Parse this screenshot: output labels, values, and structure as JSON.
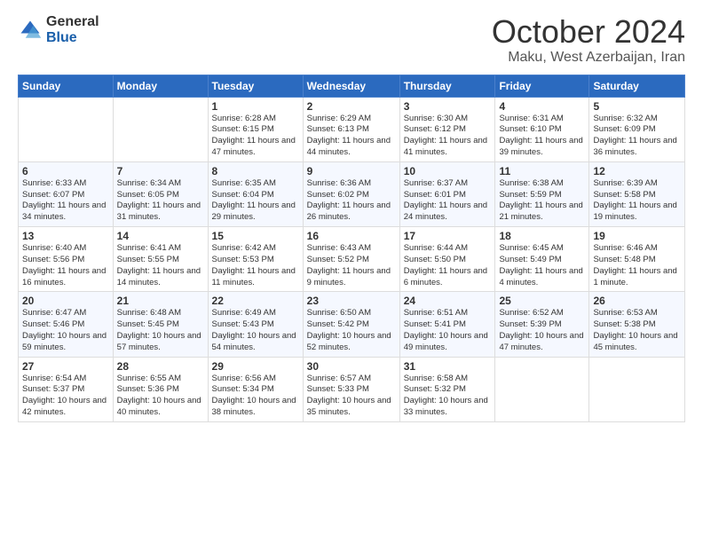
{
  "logo": {
    "general": "General",
    "blue": "Blue"
  },
  "title": {
    "month": "October 2024",
    "location": "Maku, West Azerbaijan, Iran"
  },
  "days_header": [
    "Sunday",
    "Monday",
    "Tuesday",
    "Wednesday",
    "Thursday",
    "Friday",
    "Saturday"
  ],
  "weeks": [
    [
      {
        "day": "",
        "detail": ""
      },
      {
        "day": "",
        "detail": ""
      },
      {
        "day": "1",
        "detail": "Sunrise: 6:28 AM\nSunset: 6:15 PM\nDaylight: 11 hours and 47 minutes."
      },
      {
        "day": "2",
        "detail": "Sunrise: 6:29 AM\nSunset: 6:13 PM\nDaylight: 11 hours and 44 minutes."
      },
      {
        "day": "3",
        "detail": "Sunrise: 6:30 AM\nSunset: 6:12 PM\nDaylight: 11 hours and 41 minutes."
      },
      {
        "day": "4",
        "detail": "Sunrise: 6:31 AM\nSunset: 6:10 PM\nDaylight: 11 hours and 39 minutes."
      },
      {
        "day": "5",
        "detail": "Sunrise: 6:32 AM\nSunset: 6:09 PM\nDaylight: 11 hours and 36 minutes."
      }
    ],
    [
      {
        "day": "6",
        "detail": "Sunrise: 6:33 AM\nSunset: 6:07 PM\nDaylight: 11 hours and 34 minutes."
      },
      {
        "day": "7",
        "detail": "Sunrise: 6:34 AM\nSunset: 6:05 PM\nDaylight: 11 hours and 31 minutes."
      },
      {
        "day": "8",
        "detail": "Sunrise: 6:35 AM\nSunset: 6:04 PM\nDaylight: 11 hours and 29 minutes."
      },
      {
        "day": "9",
        "detail": "Sunrise: 6:36 AM\nSunset: 6:02 PM\nDaylight: 11 hours and 26 minutes."
      },
      {
        "day": "10",
        "detail": "Sunrise: 6:37 AM\nSunset: 6:01 PM\nDaylight: 11 hours and 24 minutes."
      },
      {
        "day": "11",
        "detail": "Sunrise: 6:38 AM\nSunset: 5:59 PM\nDaylight: 11 hours and 21 minutes."
      },
      {
        "day": "12",
        "detail": "Sunrise: 6:39 AM\nSunset: 5:58 PM\nDaylight: 11 hours and 19 minutes."
      }
    ],
    [
      {
        "day": "13",
        "detail": "Sunrise: 6:40 AM\nSunset: 5:56 PM\nDaylight: 11 hours and 16 minutes."
      },
      {
        "day": "14",
        "detail": "Sunrise: 6:41 AM\nSunset: 5:55 PM\nDaylight: 11 hours and 14 minutes."
      },
      {
        "day": "15",
        "detail": "Sunrise: 6:42 AM\nSunset: 5:53 PM\nDaylight: 11 hours and 11 minutes."
      },
      {
        "day": "16",
        "detail": "Sunrise: 6:43 AM\nSunset: 5:52 PM\nDaylight: 11 hours and 9 minutes."
      },
      {
        "day": "17",
        "detail": "Sunrise: 6:44 AM\nSunset: 5:50 PM\nDaylight: 11 hours and 6 minutes."
      },
      {
        "day": "18",
        "detail": "Sunrise: 6:45 AM\nSunset: 5:49 PM\nDaylight: 11 hours and 4 minutes."
      },
      {
        "day": "19",
        "detail": "Sunrise: 6:46 AM\nSunset: 5:48 PM\nDaylight: 11 hours and 1 minute."
      }
    ],
    [
      {
        "day": "20",
        "detail": "Sunrise: 6:47 AM\nSunset: 5:46 PM\nDaylight: 10 hours and 59 minutes."
      },
      {
        "day": "21",
        "detail": "Sunrise: 6:48 AM\nSunset: 5:45 PM\nDaylight: 10 hours and 57 minutes."
      },
      {
        "day": "22",
        "detail": "Sunrise: 6:49 AM\nSunset: 5:43 PM\nDaylight: 10 hours and 54 minutes."
      },
      {
        "day": "23",
        "detail": "Sunrise: 6:50 AM\nSunset: 5:42 PM\nDaylight: 10 hours and 52 minutes."
      },
      {
        "day": "24",
        "detail": "Sunrise: 6:51 AM\nSunset: 5:41 PM\nDaylight: 10 hours and 49 minutes."
      },
      {
        "day": "25",
        "detail": "Sunrise: 6:52 AM\nSunset: 5:39 PM\nDaylight: 10 hours and 47 minutes."
      },
      {
        "day": "26",
        "detail": "Sunrise: 6:53 AM\nSunset: 5:38 PM\nDaylight: 10 hours and 45 minutes."
      }
    ],
    [
      {
        "day": "27",
        "detail": "Sunrise: 6:54 AM\nSunset: 5:37 PM\nDaylight: 10 hours and 42 minutes."
      },
      {
        "day": "28",
        "detail": "Sunrise: 6:55 AM\nSunset: 5:36 PM\nDaylight: 10 hours and 40 minutes."
      },
      {
        "day": "29",
        "detail": "Sunrise: 6:56 AM\nSunset: 5:34 PM\nDaylight: 10 hours and 38 minutes."
      },
      {
        "day": "30",
        "detail": "Sunrise: 6:57 AM\nSunset: 5:33 PM\nDaylight: 10 hours and 35 minutes."
      },
      {
        "day": "31",
        "detail": "Sunrise: 6:58 AM\nSunset: 5:32 PM\nDaylight: 10 hours and 33 minutes."
      },
      {
        "day": "",
        "detail": ""
      },
      {
        "day": "",
        "detail": ""
      }
    ]
  ]
}
